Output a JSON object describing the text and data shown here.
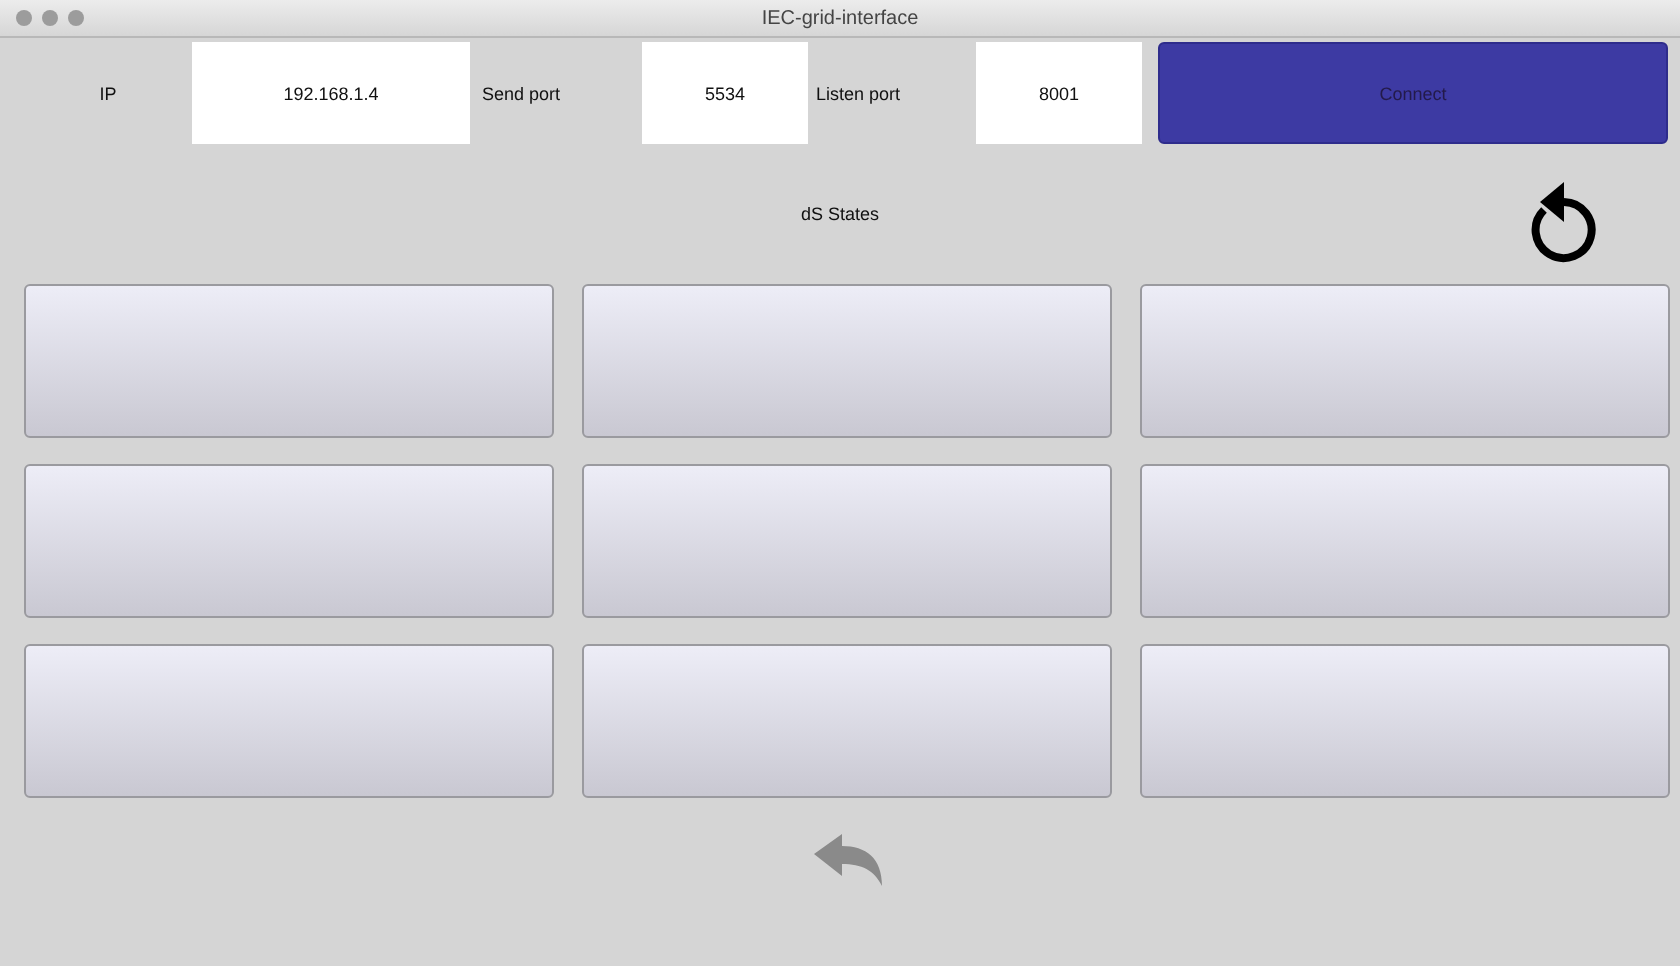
{
  "window": {
    "title": "IEC-grid-interface"
  },
  "connection": {
    "ip_label": "IP",
    "ip": "192.168.1.4",
    "send_port_label": "Send port",
    "send_port": "5534",
    "listen_port_label": "Listen port",
    "listen_port": "8001",
    "connect_button": "Connect"
  },
  "section_title": "dS States"
}
